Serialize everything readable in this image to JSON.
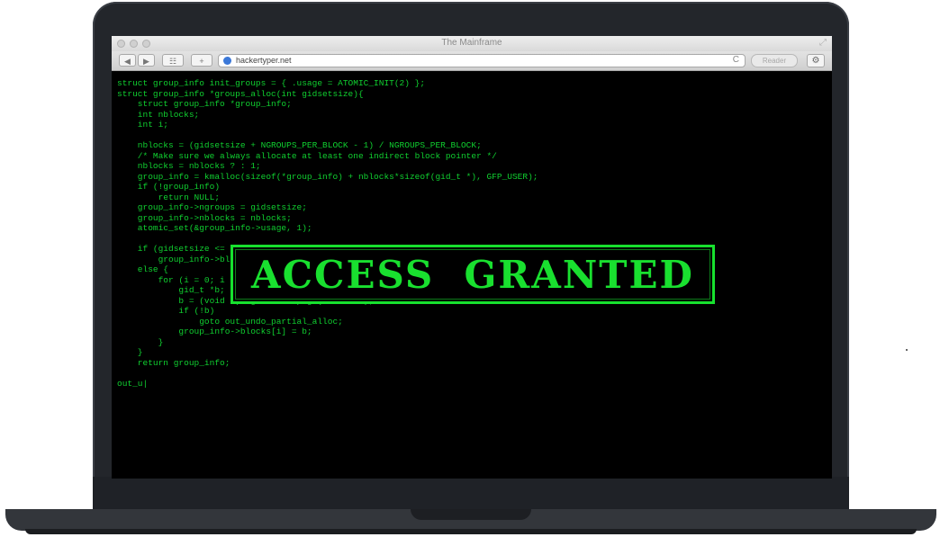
{
  "window": {
    "title": "The Mainframe"
  },
  "toolbar": {
    "back_label": "◀",
    "forward_label": "▶",
    "bookmarks_label": "☷",
    "add_label": "+",
    "url": "hackertyper.net",
    "reload_label": "C",
    "reader_label": "Reader",
    "gear_label": "⚙"
  },
  "terminal": {
    "code": "struct group_info init_groups = { .usage = ATOMIC_INIT(2) };\nstruct group_info *groups_alloc(int gidsetsize){\n    struct group_info *group_info;\n    int nblocks;\n    int i;\n\n    nblocks = (gidsetsize + NGROUPS_PER_BLOCK - 1) / NGROUPS_PER_BLOCK;\n    /* Make sure we always allocate at least one indirect block pointer */\n    nblocks = nblocks ? : 1;\n    group_info = kmalloc(sizeof(*group_info) + nblocks*sizeof(gid_t *), GFP_USER);\n    if (!group_info)\n        return NULL;\n    group_info->ngroups = gidsetsize;\n    group_info->nblocks = nblocks;\n    atomic_set(&group_info->usage, 1);\n\n    if (gidsetsize <= NGROUPS_SMALL)\n        group_info->blocks[0] = group_info->small_block;\n    else {\n        for (i = 0; i < nblocks; i++) {\n            gid_t *b;\n            b = (void *)__get_free_page(GFP_USER);\n            if (!b)\n                goto out_undo_partial_alloc;\n            group_info->blocks[i] = b;\n        }\n    }\n    return group_info;\n\nout_u|",
    "access_message": "ACCESS  GRANTED"
  },
  "colors": {
    "terminal_text": "#10d030",
    "access_green": "#19e02f",
    "laptop_body": "#23262b"
  }
}
